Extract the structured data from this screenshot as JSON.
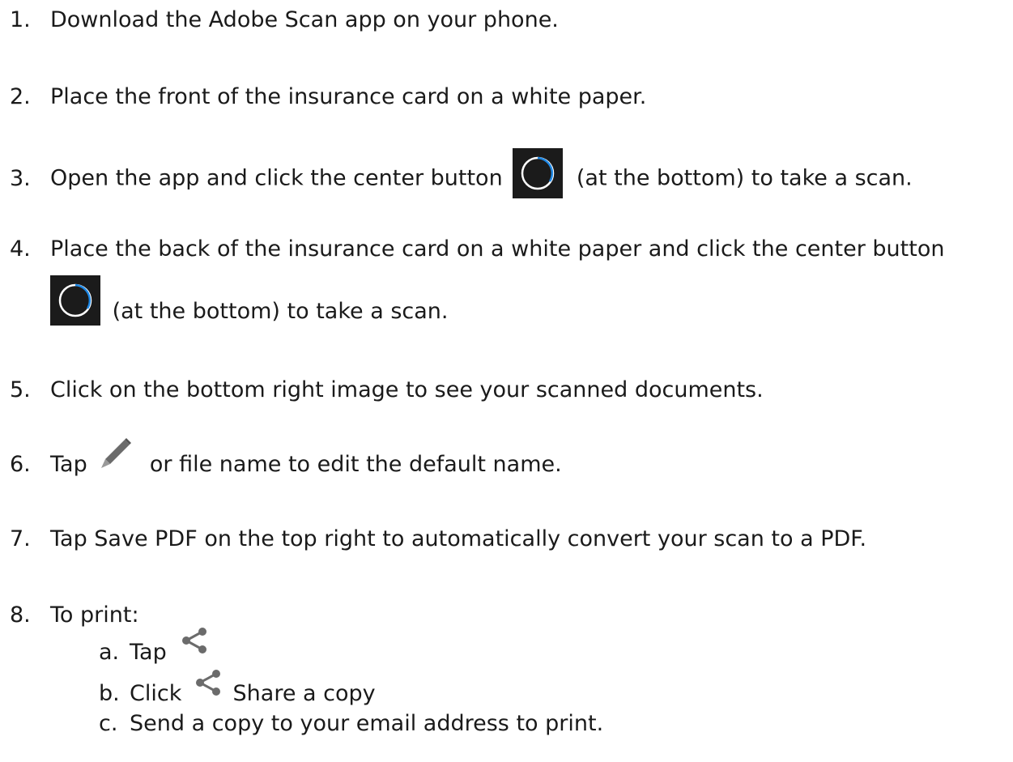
{
  "steps": [
    {
      "num": "1.",
      "text": "Download the Adobe Scan app on your phone."
    },
    {
      "num": "2.",
      "text": "Place the front of the insurance card on a white paper."
    },
    {
      "num": "3.",
      "before": "Open the app and click the center button",
      "after": "(at the bottom) to take a scan."
    },
    {
      "num": "4.",
      "line1": "Place the back of the insurance card on a white paper and click the center button",
      "after": "(at the bottom) to take a scan."
    },
    {
      "num": "5.",
      "text": "Click on the bottom right image to see your scanned documents."
    },
    {
      "num": "6.",
      "before": "Tap",
      "after": "or file name to edit the default name."
    },
    {
      "num": "7.",
      "text": "Tap Save PDF on the top right to automatically convert your scan to a PDF."
    },
    {
      "num": "8.",
      "text": "To print:"
    }
  ],
  "substeps": [
    {
      "letter": "a.",
      "before": "Tap",
      "after": ""
    },
    {
      "letter": "b.",
      "before": "Click",
      "after": "Share a copy"
    },
    {
      "letter": "c.",
      "text": "Send a copy to your email address to print."
    }
  ],
  "icons": {
    "scan_button": "scan-capture-button-icon",
    "pencil": "pencil-icon",
    "share": "share-icon"
  },
  "colors": {
    "text": "#1a1a1a",
    "scan_button_bg": "#1b1b1b",
    "scan_ring": "#ffffff",
    "scan_progress": "#1e88e5",
    "icon_gray": "#6b6b6b"
  }
}
